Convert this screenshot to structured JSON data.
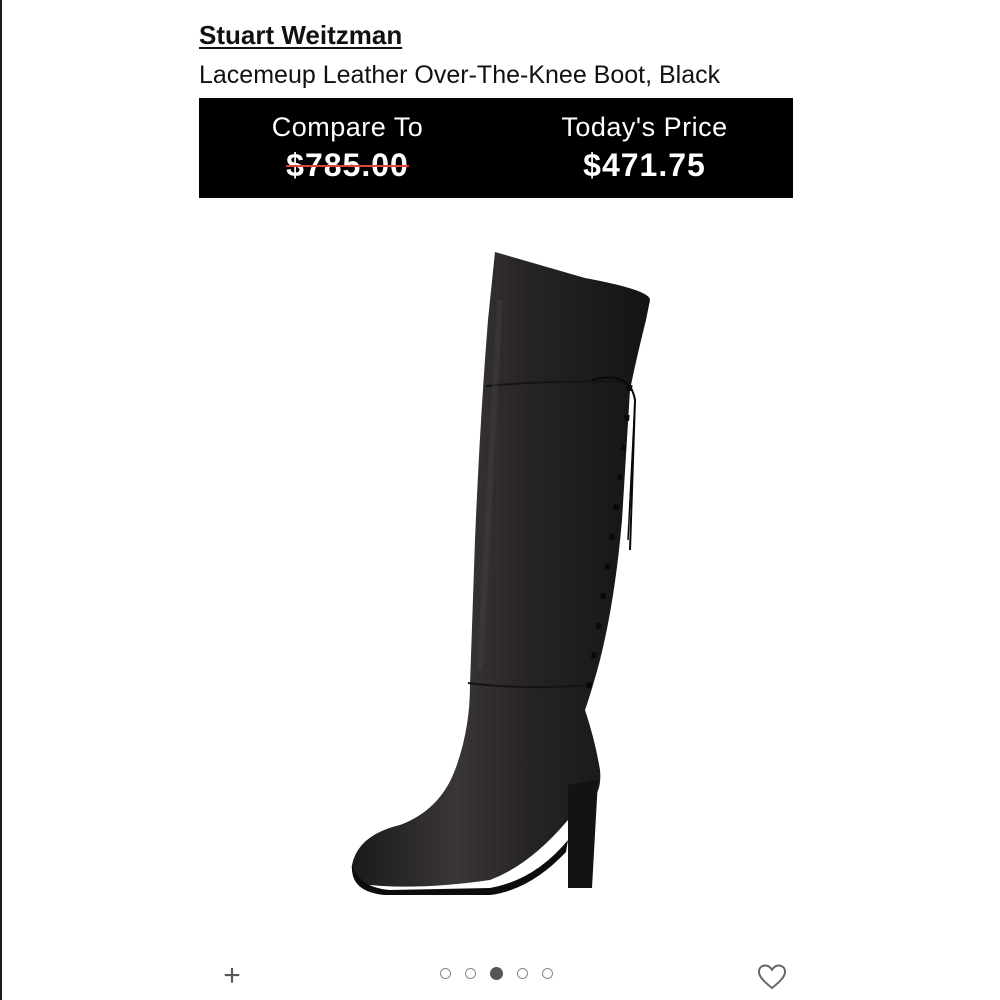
{
  "product": {
    "brand": "Stuart Weitzman",
    "name": "Lacemeup Leather Over-The-Knee Boot, Black"
  },
  "pricing": {
    "compare_label": "Compare To",
    "compare_price": "$785.00",
    "today_label": "Today's Price",
    "today_price": "$471.75"
  },
  "gallery": {
    "image_count": 5,
    "active_index": 2
  },
  "actions": {
    "add_icon": "plus-icon",
    "favorite_icon": "heart-icon"
  },
  "colors": {
    "banner_bg": "#000000",
    "strike": "#e0443c"
  }
}
